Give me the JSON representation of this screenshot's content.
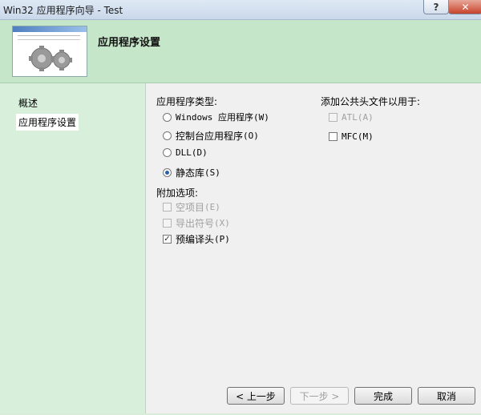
{
  "window": {
    "title": "Win32 应用程序向导 - Test",
    "help_label": "?",
    "close_label": "✕"
  },
  "header": {
    "title": "应用程序设置",
    "banner_icon": "gears-icon"
  },
  "sidebar": {
    "items": [
      {
        "label": "概述"
      },
      {
        "label": "应用程序设置",
        "selected": true
      }
    ]
  },
  "app_type": {
    "label": "应用程序类型:",
    "options": [
      {
        "label": "Windows 应用程序",
        "mnemonic": "(W)",
        "selected": false
      },
      {
        "label": "控制台应用程序",
        "mnemonic": "(O)",
        "selected": false
      },
      {
        "label": "DLL",
        "mnemonic": "(D)",
        "selected": false
      },
      {
        "label": "静态库",
        "mnemonic": "(S)",
        "selected": true
      }
    ]
  },
  "extra_options": {
    "label": "附加选项:",
    "options": [
      {
        "label": "空项目",
        "mnemonic": "(E)",
        "checked": false,
        "enabled": false
      },
      {
        "label": "导出符号",
        "mnemonic": "(X)",
        "checked": false,
        "enabled": false
      },
      {
        "label": "预编译头",
        "mnemonic": "(P)",
        "checked": true,
        "enabled": true
      }
    ]
  },
  "common_headers": {
    "label": "添加公共头文件以用于:",
    "options": [
      {
        "label": "ATL",
        "mnemonic": "(A)",
        "checked": false,
        "enabled": false
      },
      {
        "label": "MFC",
        "mnemonic": "(M)",
        "checked": false,
        "enabled": true
      }
    ]
  },
  "buttons": {
    "back": "< 上一步",
    "next": "下一步 >",
    "finish": "完成",
    "cancel": "取消"
  },
  "colors": {
    "header_bg": "#c6e6c9",
    "sidebar_bg": "#d8f0db",
    "radio_dot": "#2c5fa8"
  }
}
